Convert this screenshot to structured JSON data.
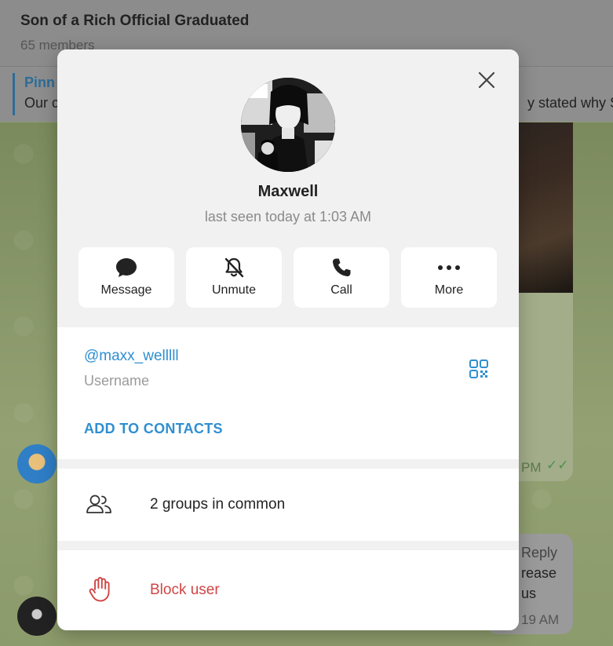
{
  "background": {
    "chat_title": "Son of a Rich Official Graduated",
    "members": "65 members",
    "pinned_label": "Pinn",
    "pinned_text_start": "Our c",
    "pinned_text_end": "y stated why S",
    "time1": "PM",
    "reply_label": "Reply",
    "msg_line1": "rease",
    "msg_line2": "us",
    "time2": "19 AM"
  },
  "profile": {
    "name": "Maxwell",
    "status": "last seen today at 1:03 AM",
    "avatar_icon": "anime-avatar-icon"
  },
  "actions": [
    {
      "label": "Message",
      "icon": "chat-bubble-icon"
    },
    {
      "label": "Unmute",
      "icon": "bell-off-icon"
    },
    {
      "label": "Call",
      "icon": "phone-icon"
    },
    {
      "label": "More",
      "icon": "more-dots-icon"
    }
  ],
  "info": {
    "username": "@maxx_welllll",
    "username_label": "Username",
    "add_contacts": "ADD TO CONTACTS",
    "groups_common": "2 groups in common",
    "block_user": "Block user"
  },
  "colors": {
    "accent": "#2f8fd0",
    "danger": "#d04545"
  }
}
